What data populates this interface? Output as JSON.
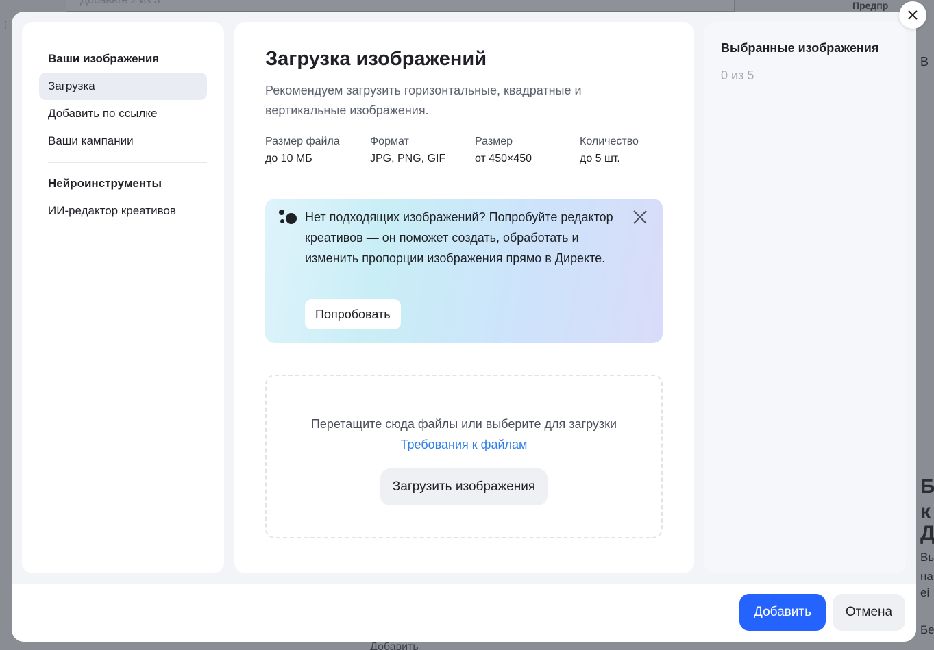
{
  "background": {
    "top_input_text": "Добавьте 2 из 3",
    "right_tab": "Предпр",
    "right_fragments": [
      "В",
      "Б",
      "к",
      "Д",
      "Вы",
      "на",
      "еі",
      "Бе"
    ],
    "bottom_text": "Добавить"
  },
  "sidebar": {
    "group1_title": "Ваши изображения",
    "items": [
      {
        "label": "Загрузка",
        "active": true
      },
      {
        "label": "Добавить по ссылке",
        "active": false
      },
      {
        "label": "Ваши кампании",
        "active": false
      }
    ],
    "group2_title": "Нейроинструменты",
    "group2_items": [
      {
        "label": "ИИ-редактор креативов"
      }
    ]
  },
  "main": {
    "title": "Загрузка изображений",
    "subtitle": "Рекомендуем загрузить горизонтальные, квадратные и вертикальные изображения.",
    "specs": [
      {
        "label": "Размер файла",
        "value": "до 10 МБ"
      },
      {
        "label": "Формат",
        "value": "JPG, PNG, GIF"
      },
      {
        "label": "Размер",
        "value": "от 450×450"
      },
      {
        "label": "Количество",
        "value": "до 5 шт."
      }
    ],
    "promo": {
      "text": "Нет подходящих изображений? Попробуйте редактор креативов — он поможет создать, обработать и изменить пропорции изображения прямо в Директе.",
      "button": "Попробовать"
    },
    "dropzone": {
      "text": "Перетащите сюда файлы или выберите для загрузки",
      "link": "Требования к файлам",
      "button": "Загрузить изображения"
    }
  },
  "selected": {
    "title": "Выбранные изображения",
    "count": "0 из 5"
  },
  "footer": {
    "primary": "Добавить",
    "secondary": "Отмена"
  },
  "colors": {
    "primary": "#2563ff",
    "link": "#2f7fe7"
  }
}
